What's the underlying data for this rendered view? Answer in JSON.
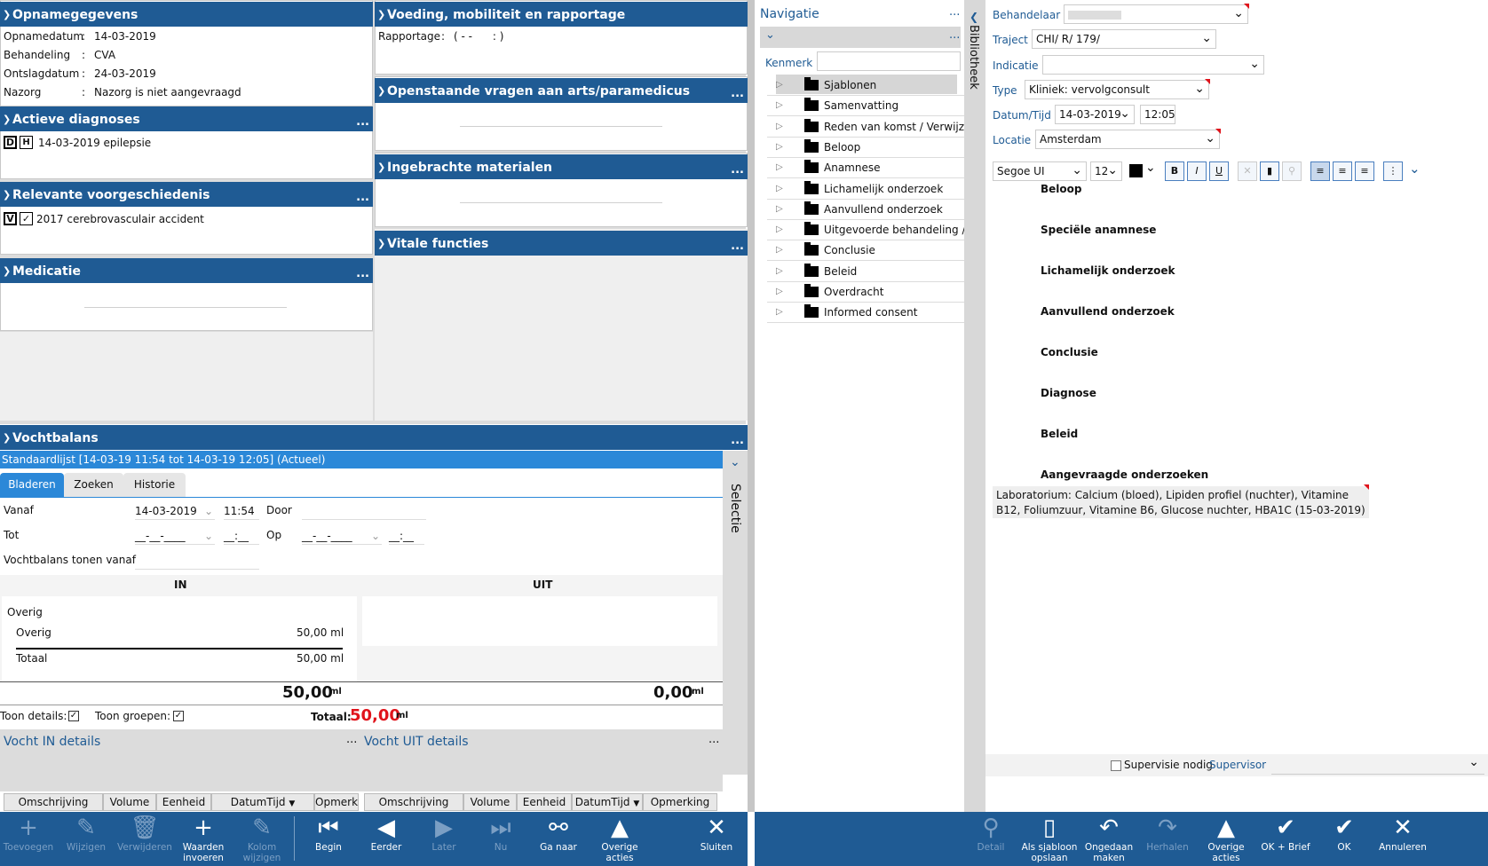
{
  "opname": {
    "title": "Opnamegegevens",
    "rows": [
      {
        "label": "Opnamedatum",
        "value": "14-03-2019"
      },
      {
        "label": "Behandeling",
        "value": "CVA"
      },
      {
        "label": "Ontslagdatum",
        "value": "24-03-2019"
      },
      {
        "label": "Nazorg",
        "value": "Nazorg is niet aangevraagd"
      }
    ]
  },
  "diagnoses": {
    "title": "Actieve diagnoses",
    "badge1": "D",
    "badge2": "H",
    "item": "14-03-2019 epilepsie"
  },
  "voorgeschiedenis": {
    "title": "Relevante voorgeschiedenis",
    "badge1": "V",
    "item": "2017 cerebrovasculair accident"
  },
  "medicatie": {
    "title": "Medicatie"
  },
  "voeding": {
    "title": "Voeding, mobiliteit en rapportage",
    "rapportage_label": "Rapportage",
    "rapportage_value": "( - -      : )"
  },
  "vragen": {
    "title": "Openstaande vragen aan arts/paramedicus"
  },
  "materialen": {
    "title": "Ingebrachte materialen"
  },
  "vitale": {
    "title": "Vitale functies"
  },
  "dots": "...",
  "vochtbalans": {
    "title": "Vochtbalans",
    "subtitle": "Standaardlijst [14-03-19 11:54 tot 14-03-19 12:05] (Actueel)",
    "tabs": [
      "Bladeren",
      "Zoeken",
      "Historie"
    ],
    "selectie": "Selectie",
    "vanaf_label": "Vanaf",
    "vanaf_date": "14-03-2019",
    "vanaf_time": "11:54",
    "door_label": "Door",
    "tot_label": "Tot",
    "tot_date": "__-__-____",
    "tot_time": "__:__",
    "op_label": "Op",
    "op_date": "__-__-____",
    "op_time": "__:__",
    "tonen_label": "Vochtbalans tonen vanaf",
    "in_label": "IN",
    "uit_label": "UIT",
    "group": "Overig",
    "row_label": "Overig",
    "row_value": "50,00 ml",
    "totaal_label": "Totaal",
    "totaal_value": "50,00 ml",
    "in_total": "50,00",
    "uit_total": "0,00",
    "unit": "ml",
    "toon_details": "Toon details:",
    "toon_groepen": "Toon groepen:",
    "totaal_text": "Totaal:",
    "totaal_big": "50,00",
    "in_details": "Vocht IN details",
    "uit_details": "Vocht UIT details",
    "in_cols": [
      "Omschrijving",
      "Volume",
      "Eenheid",
      "DatumTijd",
      "Opmerk"
    ],
    "uit_cols": [
      "Omschrijving",
      "Volume",
      "Eenheid",
      "DatumTijd",
      "Opmerking"
    ]
  },
  "toolbar_left": [
    {
      "label": "Toevoegen",
      "icon": "+",
      "enabled": false
    },
    {
      "label": "Wijzigen",
      "icon": "✎",
      "enabled": false
    },
    {
      "label": "Verwijderen",
      "icon": "🗑",
      "enabled": false
    },
    {
      "label": "Waarden invoeren",
      "icon": "+",
      "enabled": true
    },
    {
      "label": "Kolom wijzigen",
      "icon": "✎",
      "enabled": false
    },
    {
      "label": "Begin",
      "icon": "⏮",
      "enabled": true
    },
    {
      "label": "Eerder",
      "icon": "◀",
      "enabled": true
    },
    {
      "label": "Later",
      "icon": "▶",
      "enabled": false
    },
    {
      "label": "Nu",
      "icon": "⏭",
      "enabled": false
    },
    {
      "label": "Ga naar",
      "icon": "⚯",
      "enabled": true
    },
    {
      "label": "Overige acties",
      "icon": "▲",
      "enabled": true
    },
    {
      "label": "Sluiten",
      "icon": "✕",
      "enabled": true
    }
  ],
  "navigatie": {
    "title": "Navigatie",
    "kenmerk_label": "Kenmerk",
    "bibliotheek": "Bibliotheek",
    "items": [
      "Sjablonen",
      "Samenvatting",
      "Reden van komst / Verwijzing",
      "Beloop",
      "Anamnese",
      "Lichamelijk onderzoek",
      "Aanvullend onderzoek",
      "Uitgevoerde behandeling / ",
      "Conclusie",
      "Beleid",
      "Overdracht",
      "Informed consent"
    ]
  },
  "form": {
    "behandelaar_label": "Behandelaar",
    "traject_label": "Traject",
    "traject_value": "CHI/ R/ 179/",
    "indicatie_label": "Indicatie",
    "type_label": "Type",
    "type_value": "Kliniek: vervolgconsult",
    "datum_label": "Datum/Tijd",
    "datum_value": "14-03-2019",
    "tijd_value": "12:05",
    "locatie_label": "Locatie",
    "locatie_value": "Amsterdam",
    "font_value": "Segoe UI",
    "size_value": "12"
  },
  "sections": [
    "Beloop",
    "Speciële anamnese",
    "Lichamelijk onderzoek",
    "Aanvullend onderzoek",
    "Conclusie",
    "Diagnose",
    "Beleid",
    "Aangevraagde onderzoeken"
  ],
  "aangevraagd_text": "Laboratorium: Calcium (bloed), Lipiden profiel (nuchter), Vitamine B12, Foliumzuur, Vitamine B6, Glucose nuchter, HBA1C (15-03-2019)",
  "supervisie_label": "Supervisie nodig",
  "supervisor_label": "Supervisor",
  "toolbar_right": [
    {
      "label": "Detail",
      "icon": "⚲",
      "enabled": false
    },
    {
      "label": "Als sjabloon opslaan",
      "icon": "▯",
      "enabled": true
    },
    {
      "label": "Ongedaan maken",
      "icon": "↶",
      "enabled": true
    },
    {
      "label": "Herhalen",
      "icon": "↷",
      "enabled": false
    },
    {
      "label": "Overige acties",
      "icon": "▲",
      "enabled": true
    },
    {
      "label": "OK + Brief",
      "icon": "✔",
      "enabled": true
    },
    {
      "label": "OK",
      "icon": "✔",
      "enabled": true
    },
    {
      "label": "Annuleren",
      "icon": "✕",
      "enabled": true
    }
  ]
}
